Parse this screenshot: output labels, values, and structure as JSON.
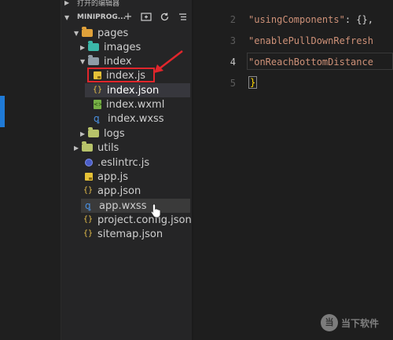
{
  "explorer": {
    "open_editors_label": "打开的编辑器",
    "project_label": "MINIPROG...",
    "tree": [
      {
        "label": "pages"
      },
      {
        "label": "images"
      },
      {
        "label": "index"
      },
      {
        "label": "index.js"
      },
      {
        "label": "index.json"
      },
      {
        "label": "index.wxml"
      },
      {
        "label": "index.wxss"
      },
      {
        "label": "logs"
      },
      {
        "label": "utils"
      },
      {
        "label": ".eslintrc.js"
      },
      {
        "label": "app.js"
      },
      {
        "label": "app.json"
      },
      {
        "label": "app.wxss"
      },
      {
        "label": "project.config.json"
      },
      {
        "label": "sitemap.json"
      }
    ]
  },
  "editor": {
    "line_numbers": [
      "2",
      "3",
      "4",
      "5"
    ],
    "lines": [
      {
        "key": "\"usingComponents\"",
        "rest": ": {},"
      },
      {
        "key": "\"enablePullDownRefresh",
        "rest": ""
      },
      {
        "key": "\"onReachBottomDistance",
        "rest": ""
      }
    ],
    "closing_brace": "}"
  },
  "watermark": {
    "logo": "当",
    "text": "当下软件"
  },
  "colors": {
    "highlight_box": "#e1262c",
    "accent": "#1f7ad6"
  }
}
